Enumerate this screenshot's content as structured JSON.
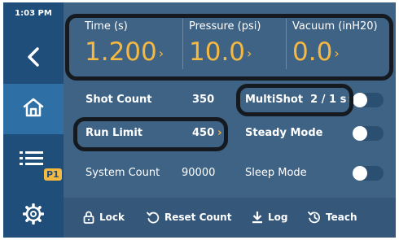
{
  "status": {
    "time": "1:03 PM"
  },
  "sidebar": {
    "items": [
      {
        "icon": "back-icon"
      },
      {
        "icon": "home-icon",
        "active": true
      },
      {
        "icon": "recipe-list-icon",
        "badge": "P1"
      },
      {
        "icon": "settings-gear-icon"
      }
    ]
  },
  "gauges": [
    {
      "label": "Time (s)",
      "value": "1.200"
    },
    {
      "label": "Pressure (psi)",
      "value": "10.0"
    },
    {
      "label": "Vacuum (inH20)",
      "value": "0.0"
    }
  ],
  "rows": {
    "shot_count": {
      "label": "Shot Count",
      "value": "350"
    },
    "run_limit": {
      "label": "Run Limit",
      "value": "450"
    },
    "system_count": {
      "label": "System Count",
      "value": "90000"
    }
  },
  "options": {
    "multishot": {
      "label": "MultiShot",
      "value": "2 / 1 s",
      "enabled": false
    },
    "steady_mode": {
      "label": "Steady Mode",
      "enabled": false
    },
    "sleep_mode": {
      "label": "Sleep Mode",
      "enabled": false
    }
  },
  "footer": {
    "lock": "Lock",
    "reset_count": "Reset Count",
    "log": "Log",
    "teach": "Teach"
  },
  "colors": {
    "sidebar": "#1e4e79",
    "sidebar_active": "#2e6fa5",
    "panel": "#3f6384",
    "footer": "#35577a",
    "accent": "#f5b942",
    "highlight_border": "#141a20"
  }
}
